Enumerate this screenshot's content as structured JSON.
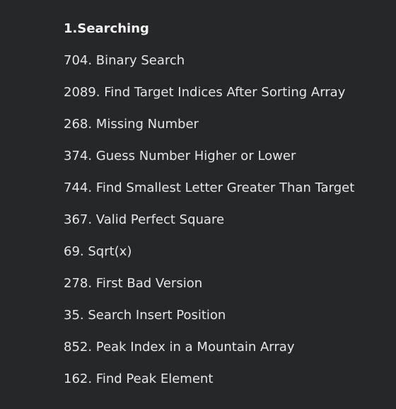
{
  "section": {
    "title": "1.Searching",
    "items": [
      "704. Binary Search",
      "2089. Find Target Indices After Sorting Array",
      "268. Missing Number",
      "374. Guess Number Higher or Lower",
      "744. Find Smallest Letter Greater Than Target",
      "367. Valid Perfect Square",
      "69. Sqrt(x)",
      "278. First Bad Version",
      "35. Search Insert Position",
      "852. Peak Index in a Mountain Array",
      "162. Find Peak Element"
    ]
  }
}
